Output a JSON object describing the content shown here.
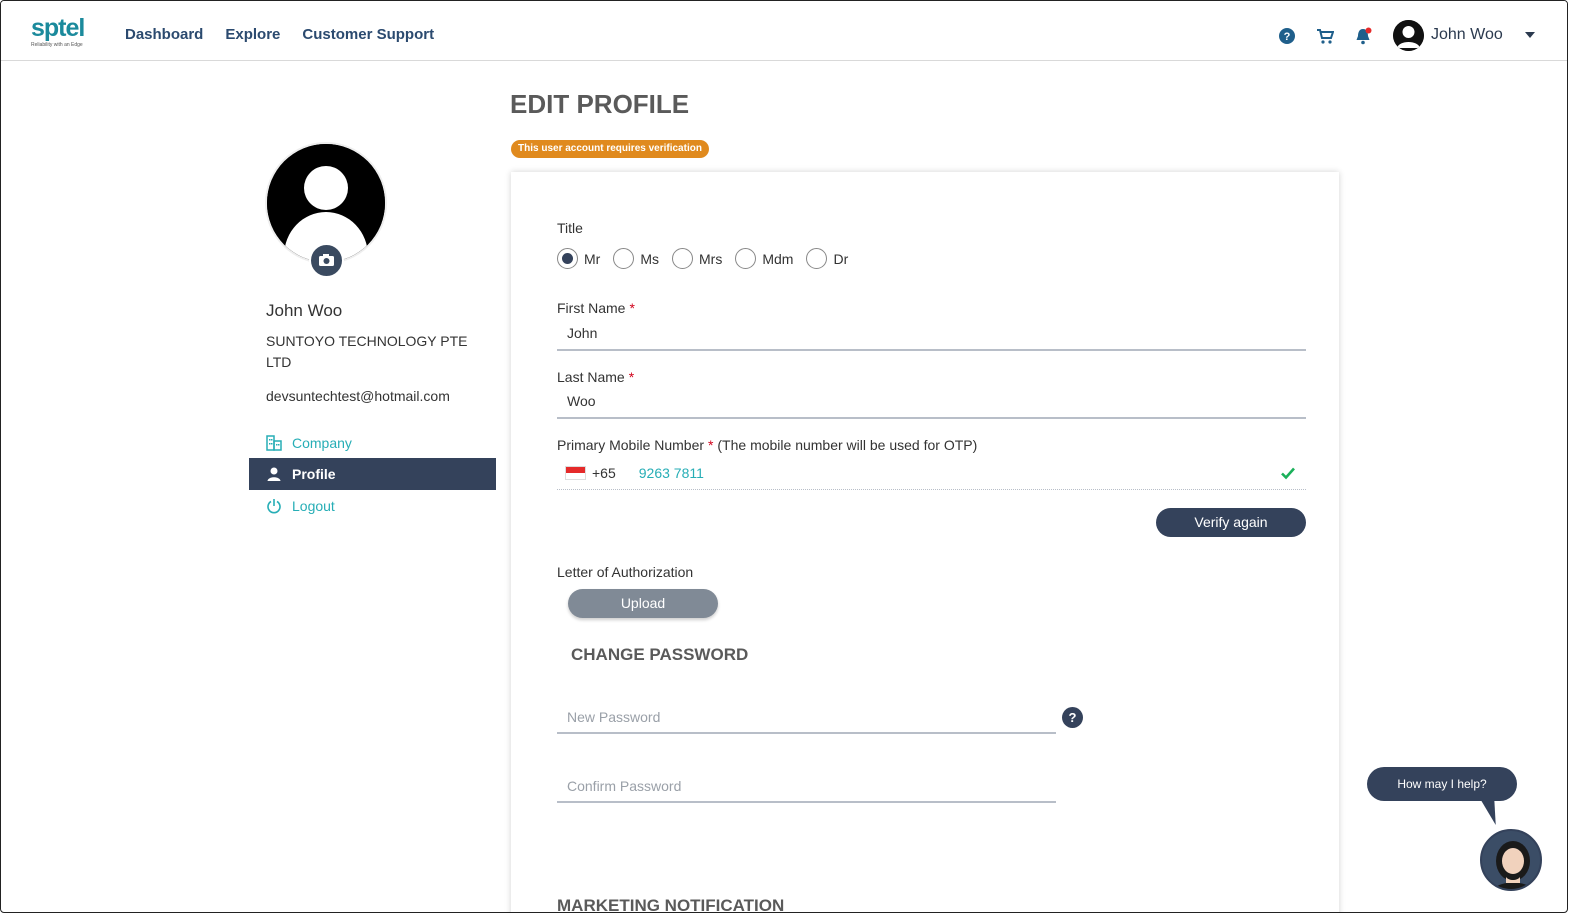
{
  "header": {
    "logo_text": "sptel",
    "logo_tagline": "Reliability with an Edge",
    "nav": [
      "Dashboard",
      "Explore",
      "Customer Support"
    ],
    "user_name": "John Woo",
    "icons": [
      "help-icon",
      "cart-icon",
      "bell-icon"
    ],
    "notification_dot_color": "#e52a2a"
  },
  "sidebar": {
    "name": "John  Woo",
    "company": "SUNTOYO TECHNOLOGY PTE LTD",
    "email": "devsuntechtest@hotmail.com",
    "items": [
      {
        "label": "Company",
        "icon": "building-icon",
        "active": false
      },
      {
        "label": "Profile",
        "icon": "user-icon",
        "active": true
      },
      {
        "label": "Logout",
        "icon": "power-icon",
        "active": false
      }
    ]
  },
  "main": {
    "title": "EDIT PROFILE",
    "verification_badge": "This user account requires verification",
    "title_field": {
      "label": "Title",
      "options": [
        "Mr",
        "Ms",
        "Mrs",
        "Mdm",
        "Dr"
      ],
      "selected": "Mr"
    },
    "first_name": {
      "label": "First Name",
      "required": "*",
      "value": "John"
    },
    "last_name": {
      "label": "Last Name",
      "required": "*",
      "value": "Woo"
    },
    "mobile": {
      "label": "Primary Mobile Number",
      "required": "*",
      "note": "(The mobile number will be used for OTP)",
      "country_code": "+65",
      "number": "9263 7811",
      "verified": true
    },
    "verify_button": "Verify again",
    "loa": {
      "label": "Letter of Authorization",
      "upload_button": "Upload"
    },
    "change_password": {
      "title": "CHANGE PASSWORD",
      "new_placeholder": "New Password",
      "confirm_placeholder": "Confirm Password"
    },
    "marketing_title": "MARKETING NOTIFICATION"
  },
  "chat": {
    "bubble": "How may I help?"
  },
  "colors": {
    "navy": "#34425b",
    "teal": "#27aeb6",
    "badge_orange": "#e08a1e",
    "check_green": "#1bb05a"
  }
}
